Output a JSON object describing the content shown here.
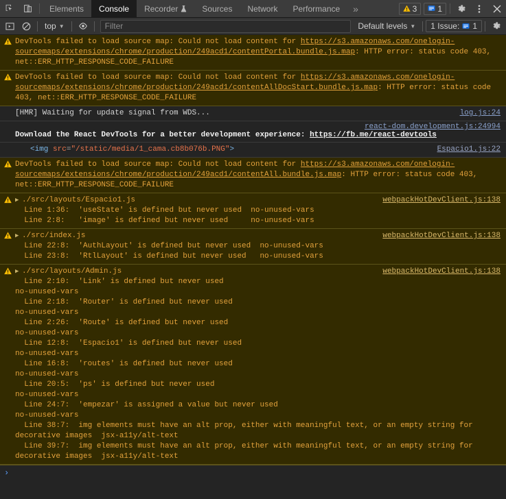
{
  "tabbar": {
    "icons": [
      {
        "name": "inspect-element-icon"
      },
      {
        "name": "device-toolbar-icon"
      }
    ],
    "tabs": [
      {
        "label": "Elements",
        "active": false,
        "flask": false
      },
      {
        "label": "Console",
        "active": true,
        "flask": false
      },
      {
        "label": "Recorder",
        "active": false,
        "flask": true
      },
      {
        "label": "Sources",
        "active": false,
        "flask": false
      },
      {
        "label": "Network",
        "active": false,
        "flask": false
      },
      {
        "label": "Performance",
        "active": false,
        "flask": false
      }
    ],
    "more_label": "»",
    "warning_count": "3",
    "info_count": "1",
    "settings_icon": "gear-icon",
    "menu_icon": "kebab-menu-icon",
    "close_icon": "close-icon"
  },
  "console_toolbar": {
    "sidebar_toggle_icon": "console-sidebar-icon",
    "clear_icon": "clear-console-icon",
    "context_label": "top",
    "eye_icon": "live-expression-icon",
    "filter_placeholder": "Filter",
    "filter_value": "",
    "levels_label": "Default levels",
    "issues_label": "1 Issue:",
    "issues_count": "1",
    "settings_icon": "console-settings-gear-icon"
  },
  "messages": [
    {
      "type": "warning",
      "id": "sourcemap-contentPortal",
      "parts": [
        {
          "t": "text",
          "v": "DevTools failed to load source map: Could not load content for "
        },
        {
          "t": "link",
          "v": "https://s3.amazonaws.com/onelogin-sourcemaps/extensions/chrome/production/249acd1/contentPortal.bundle.js.map"
        },
        {
          "t": "text",
          "v": ": HTTP error: status code 403, net::ERR_HTTP_RESPONSE_CODE_FAILURE"
        }
      ]
    },
    {
      "type": "warning",
      "id": "sourcemap-contentAllDocStart",
      "parts": [
        {
          "t": "text",
          "v": "DevTools failed to load source map: Could not load content for "
        },
        {
          "t": "link",
          "v": "https://s3.amazonaws.com/onelogin-sourcemaps/extensions/chrome/production/249acd1/contentAllDocStart.bundle.js.map"
        },
        {
          "t": "text",
          "v": ": HTTP error: status code 403, net::ERR_HTTP_RESPONSE_CODE_FAILURE"
        }
      ]
    },
    {
      "type": "log",
      "id": "hmr-waiting",
      "text": "[HMR] Waiting for update signal from WDS...",
      "source": "log.js:24"
    },
    {
      "type": "react-devtools",
      "id": "react-devtools-banner",
      "source": "react-dom.development.js:24994",
      "text_before": "Download the React DevTools for a better development experience: ",
      "link": "https://fb.me/react-devtools"
    },
    {
      "type": "dom",
      "id": "img-element",
      "tag_open": "<img",
      "attr_name": "src",
      "attr_value": "\"/static/media/1_cama.cb8b076b.PNG\"",
      "tag_close": ">",
      "source": "Espacio1.js:22"
    },
    {
      "type": "warning",
      "id": "sourcemap-contentAll",
      "parts": [
        {
          "t": "text",
          "v": "DevTools failed to load source map: Could not load content for "
        },
        {
          "t": "link",
          "v": "https://s3.amazonaws.com/onelogin-sourcemaps/extensions/chrome/production/249acd1/contentAll.bundle.js.map"
        },
        {
          "t": "text",
          "v": ": HTTP error: status code 403, net::ERR_HTTP_RESPONSE_CODE_FAILURE"
        }
      ]
    },
    {
      "type": "eslint",
      "id": "eslint-espacio1",
      "filename": "./src/layouts/Espacio1.js",
      "source": "webpackHotDevClient.js:138",
      "lines": [
        "  Line 1:36:  'useState' is defined but never used  no-unused-vars",
        "  Line 2:8:   'image' is defined but never used     no-unused-vars"
      ]
    },
    {
      "type": "eslint",
      "id": "eslint-index",
      "filename": "./src/index.js",
      "source": "webpackHotDevClient.js:138",
      "lines": [
        "  Line 22:8:  'AuthLayout' is defined but never used  no-unused-vars",
        "  Line 23:8:  'RtlLayout' is defined but never used   no-unused-vars"
      ]
    },
    {
      "type": "eslint",
      "id": "eslint-admin",
      "filename": "./src/layouts/Admin.js",
      "source": "webpackHotDevClient.js:138",
      "lines": [
        "  Line 2:10:  'Link' is defined but never used",
        "no-unused-vars",
        "  Line 2:18:  'Router' is defined but never used",
        "no-unused-vars",
        "  Line 2:26:  'Route' is defined but never used",
        "no-unused-vars",
        "  Line 12:8:  'Espacio1' is defined but never used",
        "no-unused-vars",
        "  Line 16:8:  'routes' is defined but never used",
        "no-unused-vars",
        "  Line 20:5:  'ps' is defined but never used",
        "no-unused-vars",
        "  Line 24:7:  'empezar' is assigned a value but never used",
        "no-unused-vars",
        "  Line 38:7:  img elements must have an alt prop, either with meaningful text, or an empty string for",
        "decorative images  jsx-a11y/alt-text",
        "  Line 39:7:  img elements must have an alt prop, either with meaningful text, or an empty string for",
        "decorative images  jsx-a11y/alt-text"
      ]
    }
  ],
  "prompt": {
    "arrow": "›",
    "value": ""
  },
  "colors": {
    "warning_bg": "#332b00",
    "warning_text": "#e3a23c",
    "log_bg": "#242424",
    "accent_blue": "#5a9cf8",
    "tag_blue": "#7bb7e8",
    "attr_orange": "#e8734a"
  }
}
